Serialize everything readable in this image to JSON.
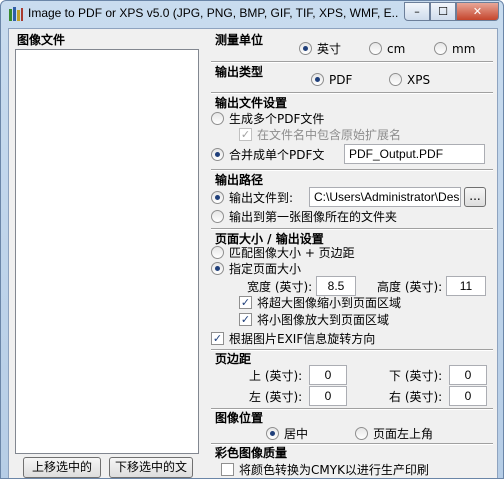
{
  "window": {
    "title": "Image to PDF or XPS  v5.0  (JPG, PNG, BMP, GIF, TIF, XPS, WMF, E...",
    "min": "–",
    "max": "☐",
    "close": "✕"
  },
  "left": {
    "header": "图像文件",
    "move_up": "上移选中的",
    "move_down": "下移选中的文"
  },
  "units": {
    "title": "测量单位",
    "options": [
      "英寸",
      "cm",
      "mm"
    ]
  },
  "output_type": {
    "title": "输出类型",
    "options": [
      "PDF",
      "XPS"
    ]
  },
  "output_settings": {
    "title": "输出文件设置",
    "multi": "生成多个PDF文件",
    "keep_ext": "在文件名中包含原始扩展名",
    "merge": "合并成单个PDF文",
    "filename": "PDF_Output.PDF"
  },
  "output_path": {
    "title": "输出路径",
    "to_folder": "输出文件到:",
    "path": "C:\\Users\\Administrator\\Deskto",
    "browse": "...",
    "first_image_folder": "输出到第一张图像所在的文件夹"
  },
  "page_size": {
    "title": "页面大小 / 输出设置",
    "match": "匹配图像大小 + 页边距",
    "specify": "指定页面大小",
    "width_label": "宽度 (英寸):",
    "width_value": "8.5",
    "height_label": "高度 (英寸):",
    "height_value": "11",
    "shrink": "将超大图像缩小到页面区域",
    "enlarge": "将小图像放大到页面区域",
    "exif": "根据图片EXIF信息旋转方向"
  },
  "margins": {
    "title": "页边距",
    "top_label": "上 (英寸):",
    "top_value": "0",
    "bottom_label": "下 (英寸):",
    "bottom_value": "0",
    "left_label": "左 (英寸):",
    "left_value": "0",
    "right_label": "右 (英寸):",
    "right_value": "0"
  },
  "position": {
    "title": "图像位置",
    "center": "居中",
    "top_left": "页面左上角"
  },
  "color_quality": {
    "title": "彩色图像质量",
    "cmyk": "将颜色转换为CMYK以进行生产印刷"
  }
}
